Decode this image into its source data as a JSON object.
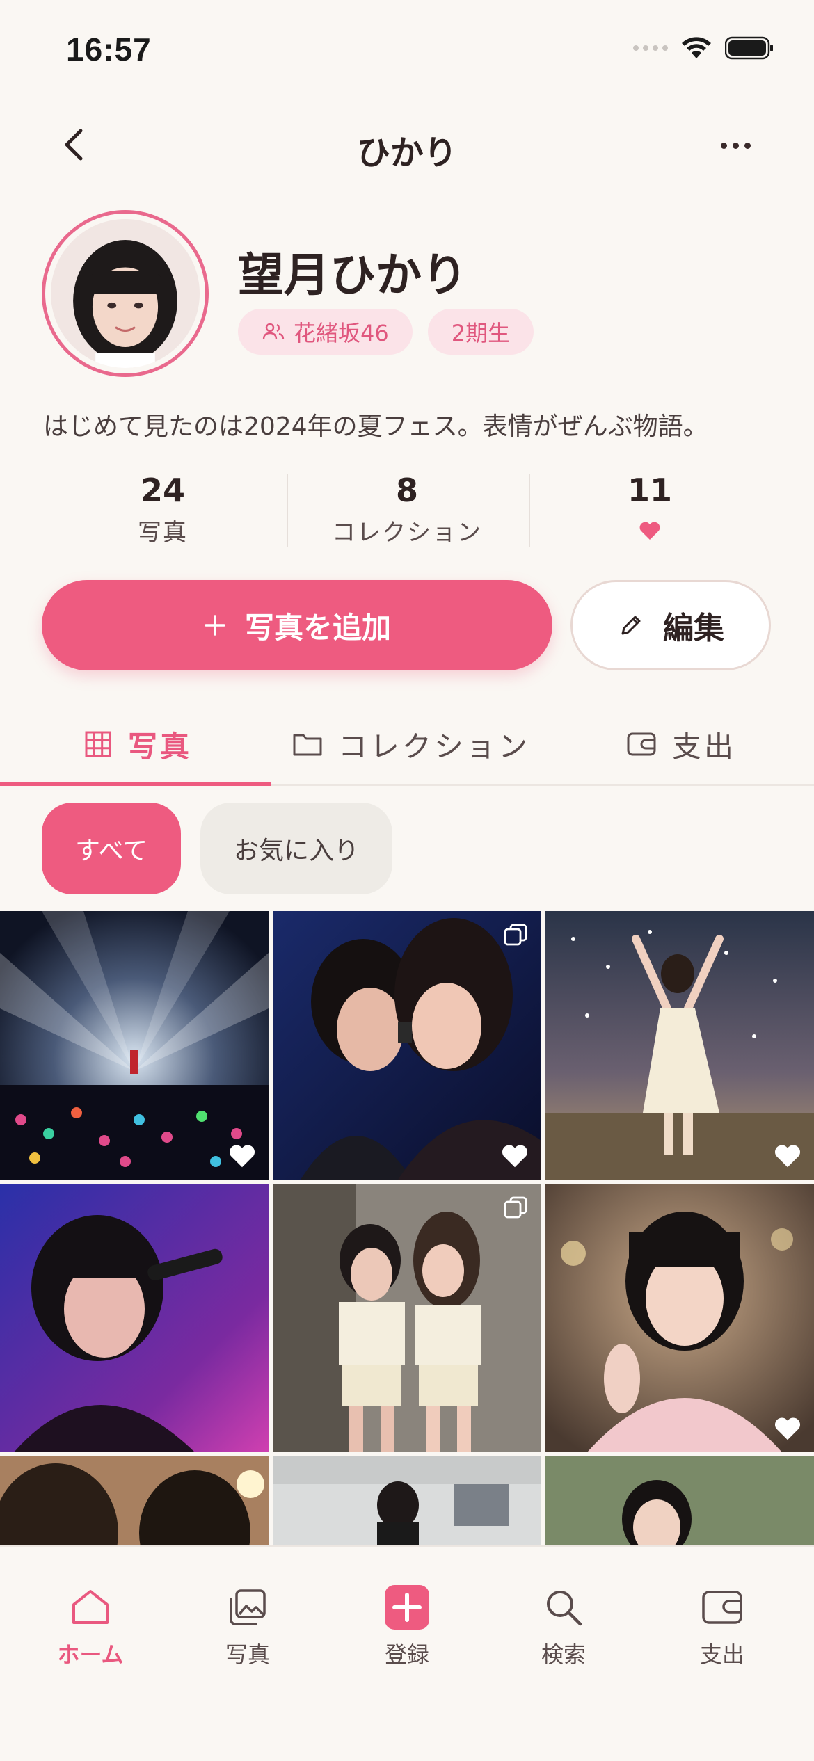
{
  "status_bar": {
    "time": "16:57"
  },
  "header": {
    "title": "ひかり"
  },
  "profile": {
    "name": "望月ひかり",
    "group_tag": "花緒坂46",
    "generation_tag": "2期生",
    "bio": "はじめて見たのは2024年の夏フェス。表情がぜんぶ物語。"
  },
  "stats": [
    {
      "value": "24",
      "label": "写真"
    },
    {
      "value": "8",
      "label": "コレクション"
    },
    {
      "value": "11",
      "label": "heart"
    }
  ],
  "actions": {
    "add_photo": "写真を追加",
    "edit": "編集"
  },
  "tabs": [
    {
      "label": "写真",
      "icon": "grid-icon",
      "active": true
    },
    {
      "label": "コレクション",
      "icon": "folder-icon",
      "active": false
    },
    {
      "label": "支出",
      "icon": "wallet-icon",
      "active": false
    }
  ],
  "filters": [
    {
      "label": "すべて",
      "active": true
    },
    {
      "label": "お気に入り",
      "active": false
    }
  ],
  "photos": [
    {
      "favorite": true,
      "multiple": false
    },
    {
      "favorite": true,
      "multiple": true
    },
    {
      "favorite": true,
      "multiple": false
    },
    {
      "favorite": false,
      "multiple": false
    },
    {
      "favorite": false,
      "multiple": true
    },
    {
      "favorite": true,
      "multiple": false
    },
    {
      "favorite": false,
      "multiple": false
    },
    {
      "favorite": false,
      "multiple": false
    },
    {
      "favorite": false,
      "multiple": false
    }
  ],
  "bottom_nav": [
    {
      "label": "ホーム",
      "icon": "home-icon",
      "active": true
    },
    {
      "label": "写真",
      "icon": "photos-icon",
      "active": false
    },
    {
      "label": "登録",
      "icon": "plus-square-icon",
      "active": false
    },
    {
      "label": "検索",
      "icon": "search-icon",
      "active": false
    },
    {
      "label": "支出",
      "icon": "wallet-icon",
      "active": false
    }
  ],
  "colors": {
    "accent": "#ee5b80",
    "background": "#faf7f3",
    "tag_bg": "#fbe3e8"
  }
}
